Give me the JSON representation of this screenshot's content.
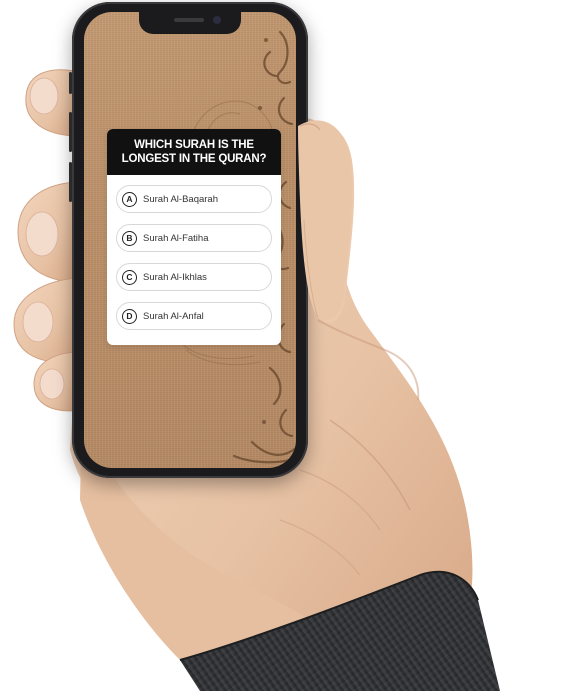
{
  "quiz": {
    "question": "WHICH SURAH IS THE LONGEST IN THE QURAN?",
    "options": [
      {
        "letter": "A",
        "label": "Surah Al-Baqarah"
      },
      {
        "letter": "B",
        "label": "Surah Al-Fatiha"
      },
      {
        "letter": "C",
        "label": "Surah Al-Ikhlas"
      },
      {
        "letter": "D",
        "label": "Surah Al-Anfal"
      }
    ]
  },
  "colors": {
    "screen_background": "#bb8f67",
    "card_header": "#111111",
    "card_body": "#ffffff",
    "phone_frame": "#1b1b1d",
    "sleeve": "#2e3033",
    "skin": "#e9c6a9"
  },
  "icons": [
    "option-letter-circle",
    "arabic-calligraphy-decoration"
  ]
}
